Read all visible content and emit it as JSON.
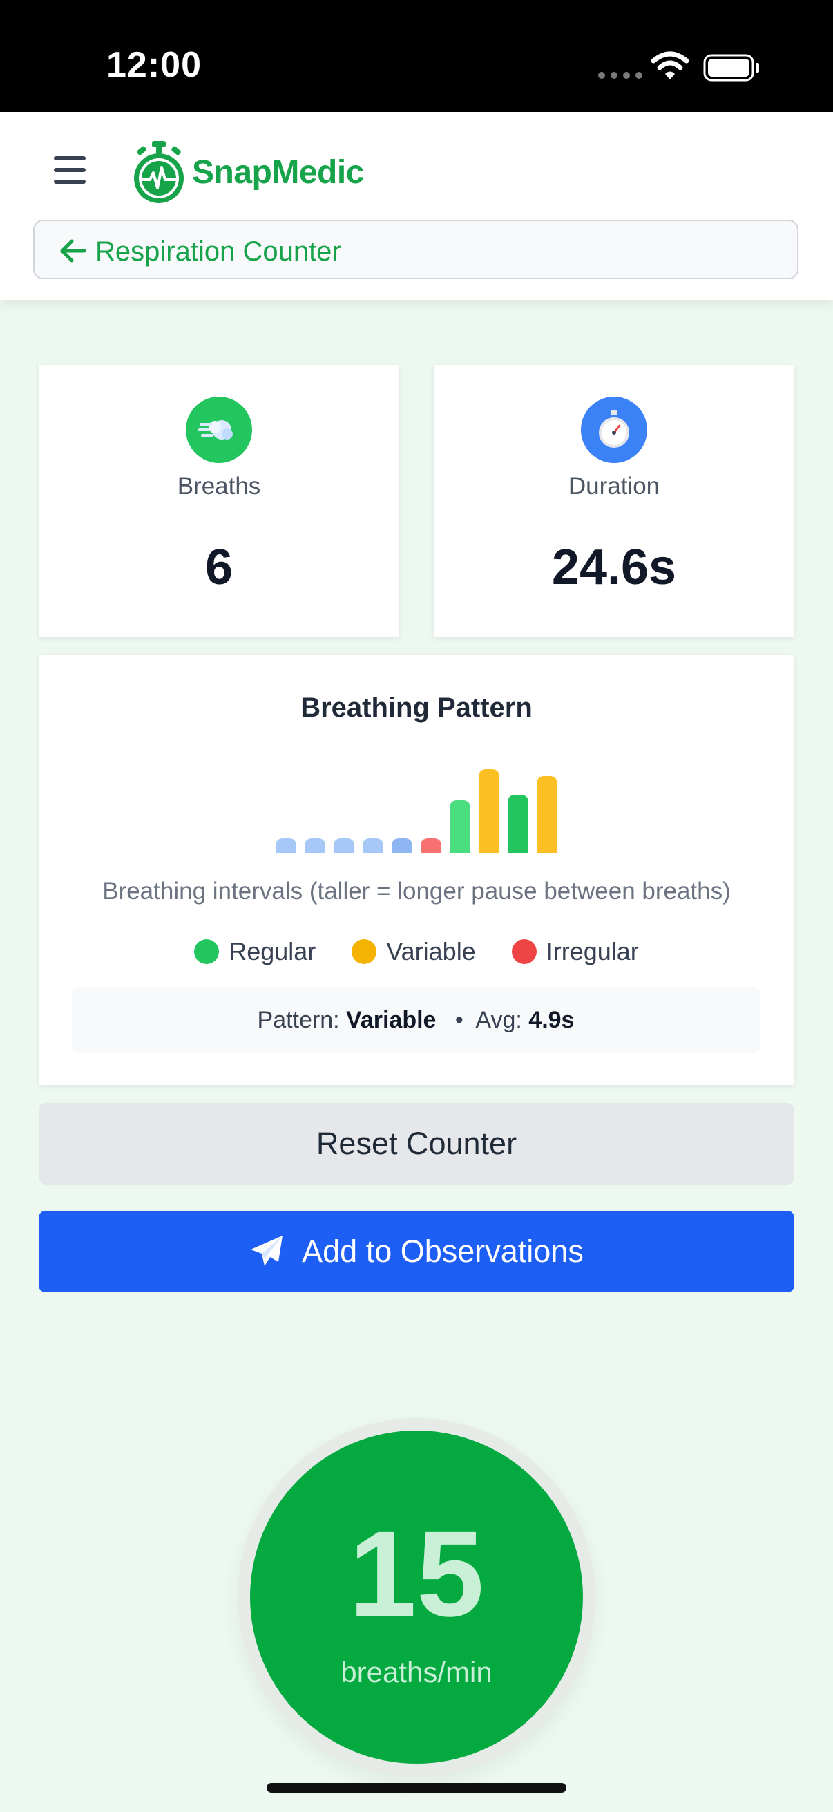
{
  "status_bar": {
    "time": "12:00"
  },
  "header": {
    "app_name": "SnapMedic",
    "page_title": "Respiration Counter",
    "icons": [
      "menu-icon",
      "stopwatch-heartbeat-logo",
      "arrow-left-icon"
    ]
  },
  "stats": {
    "breaths": {
      "label": "Breaths",
      "value": "6",
      "icon": "wind-icon",
      "icon_color": "#22c55e"
    },
    "duration": {
      "label": "Duration",
      "value": "24.6s",
      "icon": "stopwatch-icon",
      "icon_color": "#3b82f6"
    }
  },
  "pattern": {
    "title": "Breathing Pattern",
    "caption": "Breathing intervals (taller = longer pause between breaths)",
    "bars": [
      {
        "level": 0.18,
        "color": "#a6c8f8"
      },
      {
        "level": 0.18,
        "color": "#a6c8f8"
      },
      {
        "level": 0.18,
        "color": "#a6c8f8"
      },
      {
        "level": 0.18,
        "color": "#a6c8f8"
      },
      {
        "level": 0.18,
        "color": "#8db6f3"
      },
      {
        "level": 0.18,
        "color": "#f87171"
      },
      {
        "level": 0.63,
        "color": "#4ade80"
      },
      {
        "level": 1.0,
        "color": "#fbbf24"
      },
      {
        "level": 0.7,
        "color": "#22c55e"
      },
      {
        "level": 0.92,
        "color": "#fbbf24"
      }
    ],
    "legend": [
      {
        "label": "Regular",
        "color": "#22c55e"
      },
      {
        "label": "Variable",
        "color": "#f5b301"
      },
      {
        "label": "Irregular",
        "color": "#ef4444"
      }
    ],
    "summary": {
      "pattern_label": "Pattern:",
      "pattern_value": "Variable",
      "separator": "•",
      "avg_label": "Avg:",
      "avg_value": "4.9s"
    }
  },
  "actions": {
    "reset_label": "Reset Counter",
    "add_label": "Add to Observations",
    "add_icon": "paper-plane-icon",
    "primary_color": "#1d5ef5"
  },
  "rate": {
    "value": "15",
    "unit": "breaths/min",
    "color": "#04a940"
  }
}
